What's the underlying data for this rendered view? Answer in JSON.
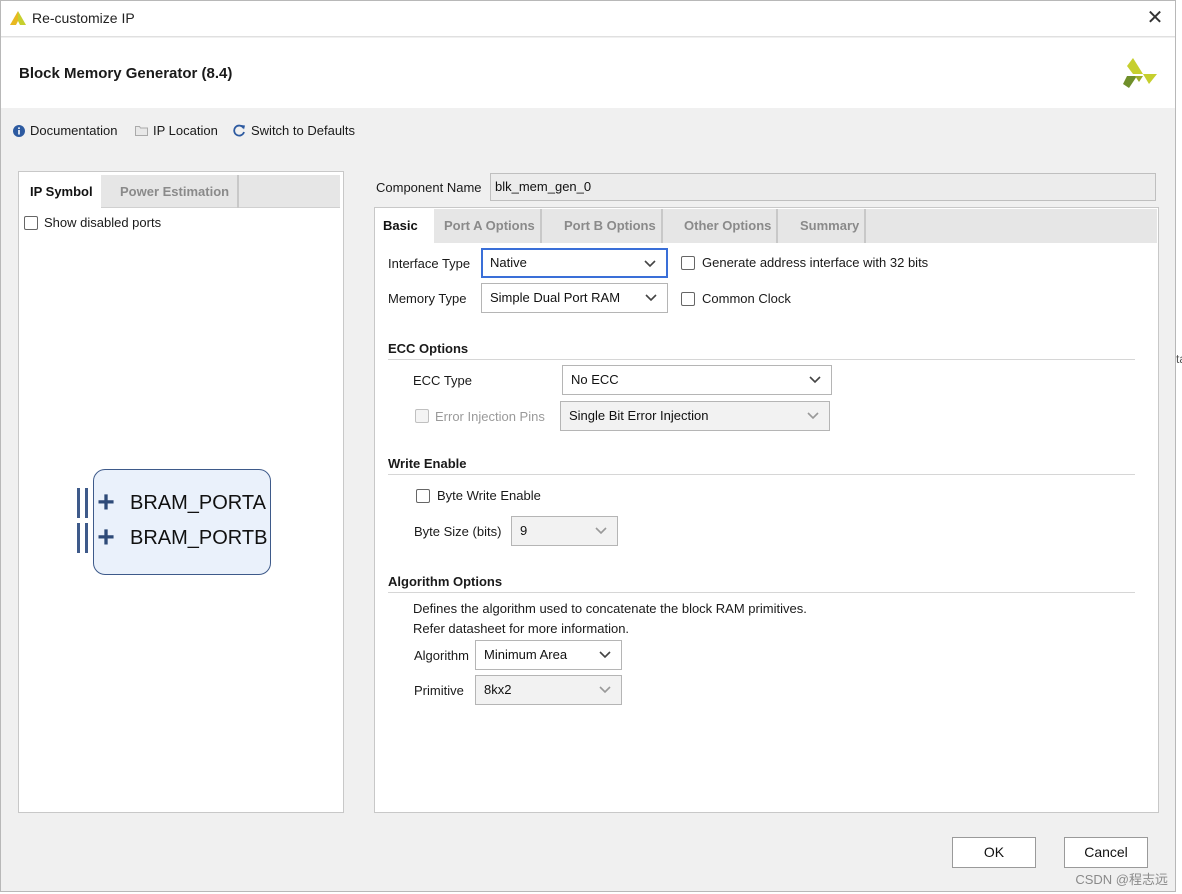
{
  "window": {
    "title": "Re-customize IP",
    "close_glyph": "✕"
  },
  "header": {
    "heading": "Block Memory Generator (8.4)",
    "logo_icon": "xilinx-logo"
  },
  "toolbar": {
    "documentation": "Documentation",
    "ip_location": "IP Location",
    "switch_defaults": "Switch to Defaults"
  },
  "left": {
    "tabs": [
      "IP Symbol",
      "Power Estimation"
    ],
    "show_disabled_ports": "Show disabled ports",
    "ports": [
      "BRAM_PORTA",
      "BRAM_PORTB"
    ]
  },
  "component": {
    "label": "Component Name",
    "value": "blk_mem_gen_0"
  },
  "tabs": [
    "Basic",
    "Port A Options",
    "Port B Options",
    "Other Options",
    "Summary"
  ],
  "basic": {
    "interface_type_label": "Interface Type",
    "interface_type_value": "Native",
    "memory_type_label": "Memory Type",
    "memory_type_value": "Simple Dual Port RAM",
    "gen_addr_32": "Generate address interface with 32 bits",
    "common_clock": "Common Clock",
    "ecc": {
      "title": "ECC Options",
      "ecc_type_label": "ECC Type",
      "ecc_type_value": "No ECC",
      "error_injection_label": "Error Injection Pins",
      "error_injection_value": "Single Bit Error Injection"
    },
    "write_enable": {
      "title": "Write Enable",
      "byte_write_enable": "Byte Write Enable",
      "byte_size_label": "Byte Size (bits)",
      "byte_size_value": "9"
    },
    "algorithm": {
      "title": "Algorithm Options",
      "desc_line1": "Defines the algorithm used to concatenate the block RAM primitives.",
      "desc_line2": "Refer datasheet for more information.",
      "algorithm_label": "Algorithm",
      "algorithm_value": "Minimum Area",
      "primitive_label": "Primitive",
      "primitive_value": "8kx2"
    }
  },
  "buttons": {
    "ok": "OK",
    "cancel": "Cancel"
  },
  "watermark": "CSDN @程志远",
  "edge_glyph": "ta",
  "colors": {
    "focus_border": "#3a6fd8",
    "symbol_fill": "#eaf1fb",
    "symbol_stroke": "#3e5a8a",
    "logo_yellow": "#c6cf2e",
    "logo_green": "#6f8f2a"
  }
}
